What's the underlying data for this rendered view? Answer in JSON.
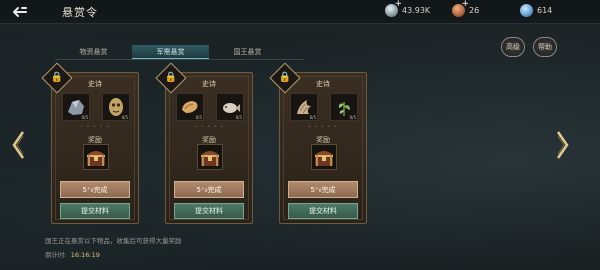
{
  "header": {
    "title": "悬赏令",
    "currencies": [
      {
        "icon": "silver-coin-icon",
        "value": "43.93K",
        "has_plus": true
      },
      {
        "icon": "copper-coin-icon",
        "value": "26",
        "has_plus": true
      },
      {
        "icon": "gem-icon",
        "value": "614",
        "has_plus": false
      }
    ],
    "plus": "+"
  },
  "tabs": [
    {
      "label": "物资悬赏",
      "active": false
    },
    {
      "label": "军需悬赏",
      "active": true
    },
    {
      "label": "国王悬赏",
      "active": false
    }
  ],
  "top_buttons": {
    "advanced": "高级",
    "help": "帮助"
  },
  "cards": [
    {
      "rarity": "史诗",
      "items": [
        {
          "icon": "ore-icon",
          "qty": "0/5"
        },
        {
          "icon": "mask-icon",
          "qty": "0/5"
        }
      ],
      "reward_label": "奖励",
      "complete_label": "5⁺₀完成",
      "submit_label": "提交材料"
    },
    {
      "rarity": "史诗",
      "items": [
        {
          "icon": "meat-icon",
          "qty": "0/5"
        },
        {
          "icon": "fish-icon",
          "qty": "0/5"
        }
      ],
      "reward_label": "奖励",
      "complete_label": "5⁺₀完成",
      "submit_label": "提交材料"
    },
    {
      "rarity": "史诗",
      "items": [
        {
          "icon": "claw-icon",
          "qty": "0/5"
        },
        {
          "icon": "herb-icon",
          "qty": "0/5"
        }
      ],
      "reward_label": "奖励",
      "complete_label": "5⁺₀完成",
      "submit_label": "提交材料"
    }
  ],
  "footer": {
    "description": "国王正在悬赏以下物品，收集后可获得大量奖励",
    "countdown_label": "倒计时:",
    "countdown_value": "16:16:19"
  },
  "colors": {
    "accent_tab": "#2f5a63",
    "complete_button": "#a07a5e",
    "submit_button": "#416a58",
    "timer": "#d9c979"
  }
}
